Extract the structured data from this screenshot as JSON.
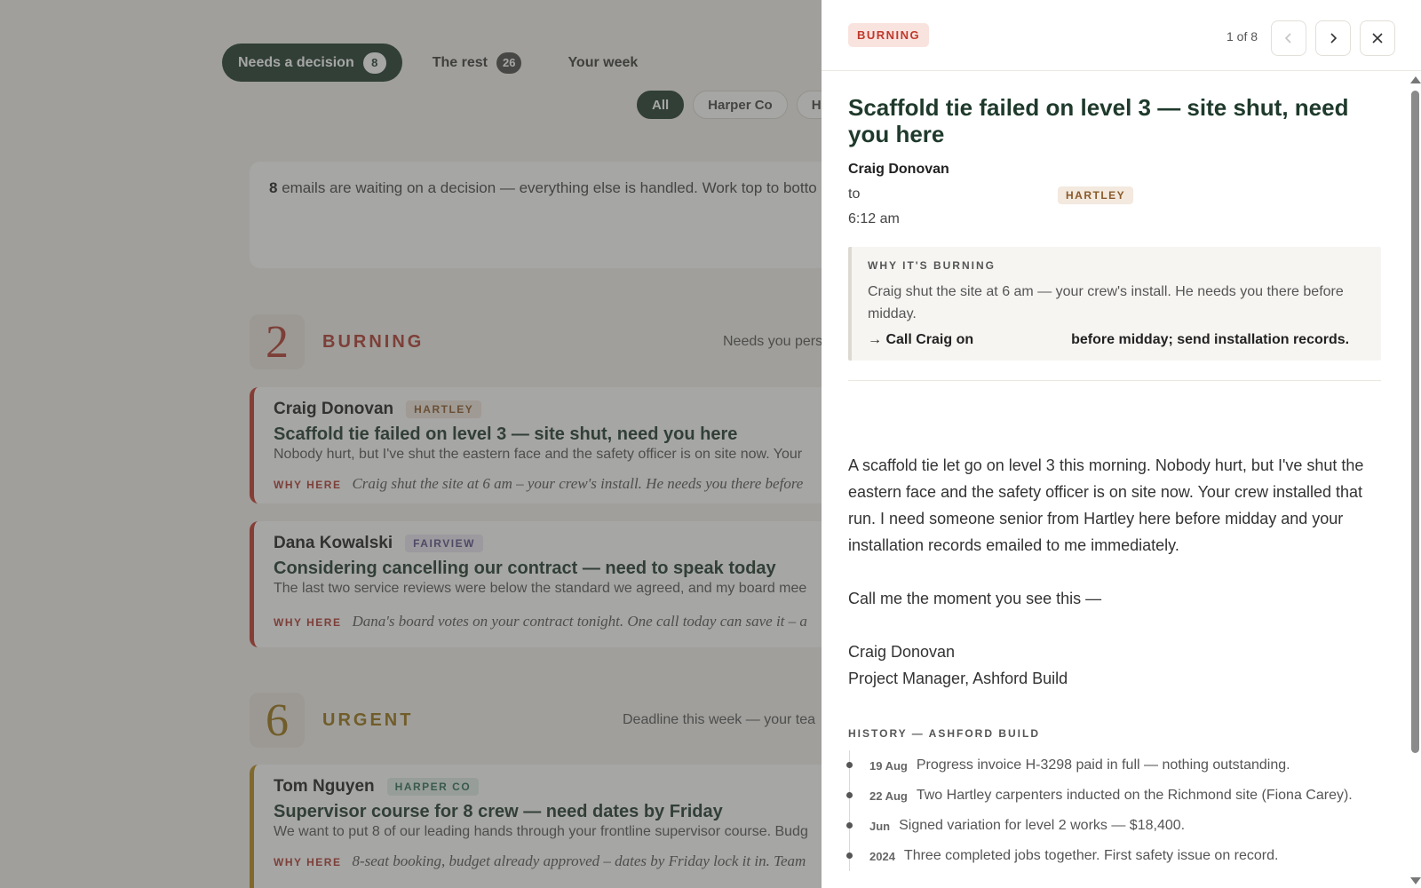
{
  "tabs": [
    {
      "label": "Needs a decision",
      "count": "8"
    },
    {
      "label": "The rest",
      "count": "26"
    },
    {
      "label": "Your week"
    }
  ],
  "filters": [
    "All",
    "Harper Co",
    "Ha"
  ],
  "summary": {
    "count": "8",
    "text": " emails are waiting on a decision — everything else is handled. Work top to botto"
  },
  "sections": {
    "burning": {
      "number": "2",
      "title": "BURNING",
      "note": "Needs you pers",
      "color": "#b03a2e"
    },
    "urgent": {
      "number": "6",
      "title": "URGENT",
      "note": "Deadline this week — your tea",
      "color": "#9a7414"
    }
  },
  "cards": [
    {
      "name": "Craig Donovan",
      "tag": "HARTLEY",
      "subject": "Scaffold tie failed on level 3 — site shut, need you here",
      "preview": "Nobody hurt, but I've shut the eastern face and the safety officer is on site now. Your",
      "why_label": "WHY HERE",
      "why": "Craig shut the site at 6 am – your crew's install. He needs you there before",
      "accent": "#c0392b"
    },
    {
      "name": "Dana Kowalski",
      "tag": "FAIRVIEW",
      "subject": "Considering cancelling our contract — need to speak today",
      "preview": "The last two service reviews were below the standard we agreed, and my board mee",
      "why_label": "WHY HERE",
      "why": "Dana's board votes on your contract tonight. One call today can save it – a",
      "accent": "#c0392b"
    },
    {
      "name": "Tom Nguyen",
      "tag": "HARPER CO",
      "subject": "Supervisor course for 8 crew — need dates by Friday",
      "preview": "We want to put 8 of our leading hands through your frontline supervisor course. Budg",
      "why_label": "WHY HERE",
      "why": "8-seat booking, budget already approved – dates by Friday lock it in. Team",
      "accent": "#b88a1a"
    }
  ],
  "panel": {
    "badge": "BURNING",
    "pager": "1 of 8",
    "subject": "Scaffold tie failed on level 3 — site shut, need you here",
    "from": "Craig Donovan",
    "to_label": "to",
    "to_tag": "HARTLEY",
    "time": "6:12 am",
    "why_label": "WHY IT'S BURNING",
    "why_text": "Craig shut the site at 6 am — your crew's install. He needs you there before midday.",
    "action_start": "→ Call Craig on",
    "action_end": "before midday; send installation records.",
    "body": [
      "A scaffold tie let go on level 3 this morning. Nobody hurt, but I've shut the eastern face and the safety officer is on site now. Your crew installed that run. I need someone senior from Hartley here before midday and your installation records emailed to me immediately.",
      "Call me the moment you see this —"
    ],
    "signature_name": "Craig Donovan",
    "signature_title": "Project Manager, Ashford Build",
    "history_label": "HISTORY — ASHFORD BUILD",
    "history": [
      {
        "date": "19 Aug",
        "text": "Progress invoice H-3298 paid in full — nothing outstanding."
      },
      {
        "date": "22 Aug",
        "text": "Two Hartley carpenters inducted on the Richmond site (Fiona Carey)."
      },
      {
        "date": "Jun",
        "text": "Signed variation for level 2 works — $18,400."
      },
      {
        "date": "2024",
        "text": "Three completed jobs together. First safety issue on record."
      }
    ]
  },
  "icons": {
    "prev": "chevron-left-icon",
    "next": "chevron-right-icon",
    "close": "close-icon"
  }
}
